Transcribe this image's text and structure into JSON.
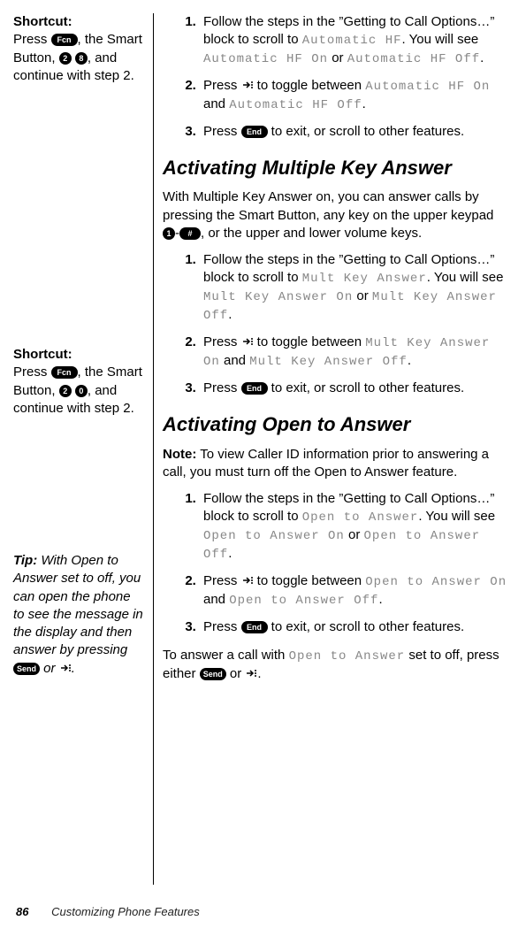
{
  "sidebar": {
    "block1": {
      "label": "Shortcut:",
      "text_a": "Press ",
      "key_fcn": "Fcn",
      "text_b": ", the Smart Button, ",
      "key_2": "2",
      "key_8": "8",
      "text_c": ", and continue with step 2."
    },
    "block2": {
      "label": "Shortcut:",
      "text_a": "Press ",
      "key_fcn": "Fcn",
      "text_b": ", the Smart Button, ",
      "key_2": "2",
      "key_0": "0",
      "text_c": ", and continue with step 2."
    },
    "tip": {
      "label": "Tip:",
      "text_a": " With Open to Answer set to off, you can open the phone to see the message in the display and then answer by pressing ",
      "key_send": "Send",
      "text_b": " or ",
      "text_c": "."
    }
  },
  "keys": {
    "end": "End",
    "send": "Send",
    "one": "1",
    "hash": "#"
  },
  "autohf": {
    "step1_a": "Follow the steps in the ”Getting to Call Options…” block to scroll to ",
    "lcd_autohf": "Automatic HF",
    "step1_b": ". You will see ",
    "lcd_autohf_on": "Automatic HF On",
    "step1_c": " or ",
    "lcd_autohf_off": "Automatic HF Off",
    "dot": ".",
    "step2_a": "Press ",
    "step2_b": " to toggle between ",
    "step2_c": " and ",
    "step3_a": "Press ",
    "step3_b": " to exit, or scroll to other features."
  },
  "headings": {
    "h1": "Activating Multiple Key Answer",
    "h2": "Activating Open to Answer"
  },
  "mka": {
    "intro_a": "With Multiple Key Answer on, you can answer calls by pressing the Smart Button, any key on the upper keypad ",
    "intro_b": "-",
    "intro_c": ", or the upper and lower volume keys.",
    "step1_a": "Follow the steps in the ”Getting to Call Options…” block to scroll to ",
    "lcd_mka": "Mult Key Answer",
    "step1_b": ". You will see ",
    "lcd_mka_on": "Mult Key Answer On",
    "step1_c": " or ",
    "lcd_mka_off": "Mult Key Answer Off",
    "dot": ".",
    "step2_a": "Press ",
    "step2_b": " to toggle between ",
    "step2_c": " and ",
    "step3_a": "Press ",
    "step3_b": " to exit, or scroll to other features."
  },
  "ota": {
    "note_label": "Note:",
    "note_text": " To view Caller ID information prior to answering a call, you must turn off the Open to Answer feature.",
    "step1_a": "Follow the steps in the ”Getting to Call Options…” block to scroll to ",
    "lcd_ota": "Open to Answer",
    "step1_b": ". You will see ",
    "lcd_ota_on": "Open to Answer On",
    "step1_c": " or ",
    "lcd_ota_off": "Open to Answer Off",
    "dot": ".",
    "step2_a": "Press ",
    "step2_b": " to toggle between ",
    "step2_c": " and ",
    "step3_a": "Press ",
    "step3_b": " to exit, or scroll to other features.",
    "closing_a": "To answer a call with ",
    "closing_b": " set to off, press either ",
    "closing_c": " or ",
    "closing_d": "."
  },
  "footer": {
    "page": "86",
    "chapter": "Customizing Phone Features"
  }
}
